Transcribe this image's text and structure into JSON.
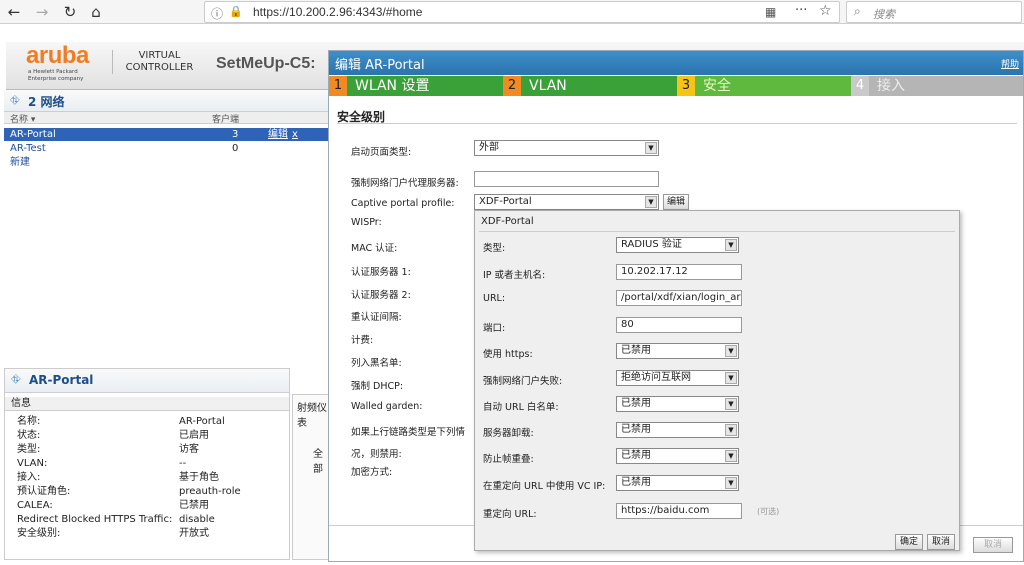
{
  "browser": {
    "url": "https://10.200.2.96:4343/#home",
    "search_placeholder": "搜索"
  },
  "header": {
    "logo": "aruba",
    "logo_sub": "a Hewlett Packard Enterprise company",
    "vc_label_1": "VIRTUAL",
    "vc_label_2": "CONTROLLER",
    "site_name": "SetMeUp-C5:"
  },
  "networks": {
    "title": "2 网络",
    "col_name": "名称",
    "col_clients": "客户端",
    "rows": [
      {
        "name": "AR-Portal",
        "clients": "3",
        "edit": "编辑",
        "delete": "x"
      },
      {
        "name": "AR-Test",
        "clients": "0"
      }
    ],
    "new_label": "新建"
  },
  "info_panel": {
    "title": "AR-Portal",
    "header": "信息",
    "tab_stub": "射频仪表",
    "tab_stub2": "全部",
    "rows": [
      {
        "k": "名称:",
        "v": "AR-Portal"
      },
      {
        "k": "状态:",
        "v": "已启用"
      },
      {
        "k": "类型:",
        "v": "访客"
      },
      {
        "k": "VLAN:",
        "v": "--"
      },
      {
        "k": "接入:",
        "v": "基于角色"
      },
      {
        "k": "预认证角色:",
        "v": "preauth-role"
      },
      {
        "k": "CALEA:",
        "v": "已禁用"
      },
      {
        "k": "Redirect Blocked HTTPS Traffic:",
        "v": "disable"
      },
      {
        "k": "安全级别:",
        "v": "开放式"
      }
    ]
  },
  "wizard": {
    "title": "编辑 AR-Portal",
    "help": "帮助",
    "steps": [
      {
        "num": "1",
        "label": "WLAN 设置"
      },
      {
        "num": "2",
        "label": "VLAN"
      },
      {
        "num": "3",
        "label": "安全"
      },
      {
        "num": "4",
        "label": "接入"
      }
    ],
    "section": "安全级别",
    "fields": {
      "splash_type_label": "启动页面类型:",
      "splash_type_value": "外部",
      "proxy_label": "强制网络门户代理服务器:",
      "proxy_value": "",
      "profile_label": "Captive portal profile:",
      "profile_value": "XDF-Portal",
      "profile_edit": "编辑",
      "wispr_label": "WISPr:",
      "mac_label": "MAC 认证:",
      "auth1_label": "认证服务器 1:",
      "auth2_label": "认证服务器 2:",
      "reauth_label": "重认证间隔:",
      "accounting_label": "计费:",
      "blacklist_label": "列入黑名单:",
      "dhcp_label": "强制 DHCP:",
      "walled_label": "Walled garden:",
      "uplink_label_1": "如果上行链路类型是下列情",
      "uplink_label_2": "况，则禁用:",
      "encrypt_label": "加密方式:"
    },
    "cancel": "取消"
  },
  "popup": {
    "title": "XDF-Portal",
    "fields": [
      {
        "label": "类型:",
        "kind": "select",
        "value": "RADIUS 验证"
      },
      {
        "label": "IP 或者主机名:",
        "kind": "input",
        "value": "10.202.17.12"
      },
      {
        "label": "URL:",
        "kind": "input",
        "value": "/portal/xdf/xian/login_aruba.h"
      },
      {
        "label": "端口:",
        "kind": "input",
        "value": "80"
      },
      {
        "label": "使用 https:",
        "kind": "select",
        "value": "已禁用"
      },
      {
        "label": "强制网络门户失败:",
        "kind": "select",
        "value": "拒绝访问互联网"
      },
      {
        "label": "自动 URL 白名单:",
        "kind": "select",
        "value": "已禁用"
      },
      {
        "label": "服务器卸载:",
        "kind": "select",
        "value": "已禁用"
      },
      {
        "label": "防止帧重叠:",
        "kind": "select",
        "value": "已禁用"
      },
      {
        "label": "在重定向 URL 中使用 VC IP:",
        "kind": "select",
        "value": "已禁用"
      },
      {
        "label": "重定向 URL:",
        "kind": "input",
        "value": "https://baidu.com"
      }
    ],
    "optional_note": "(可选)",
    "ok": "确定",
    "cancel": "取消"
  }
}
